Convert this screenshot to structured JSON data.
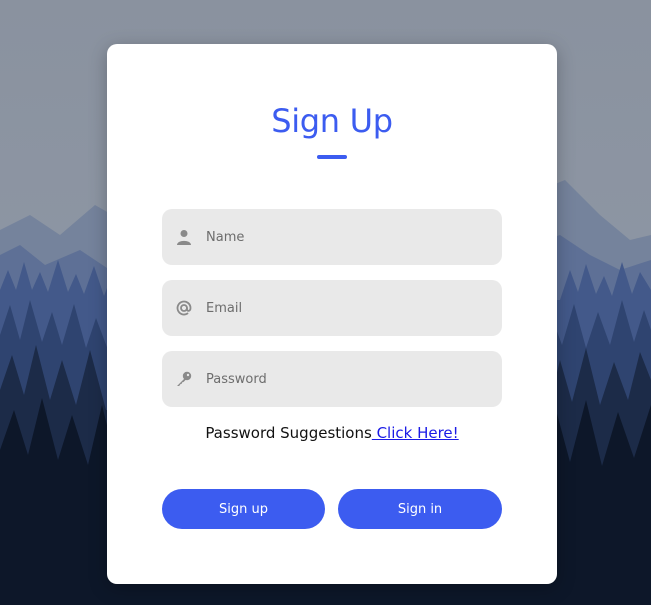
{
  "form": {
    "title": "Sign Up",
    "name_placeholder": "Name",
    "email_placeholder": "Email",
    "password_placeholder": "Password",
    "suggestion_text": "Password Suggestions",
    "suggestion_link": " Click Here!",
    "signup_label": "Sign up",
    "signin_label": "Sign in"
  },
  "icons": {
    "name": "person-icon",
    "email": "at-sign-icon",
    "password": "key-icon"
  },
  "colors": {
    "accent": "#3c5cf0",
    "field_bg": "#e9e9e9",
    "link": "#1a1ae6"
  }
}
